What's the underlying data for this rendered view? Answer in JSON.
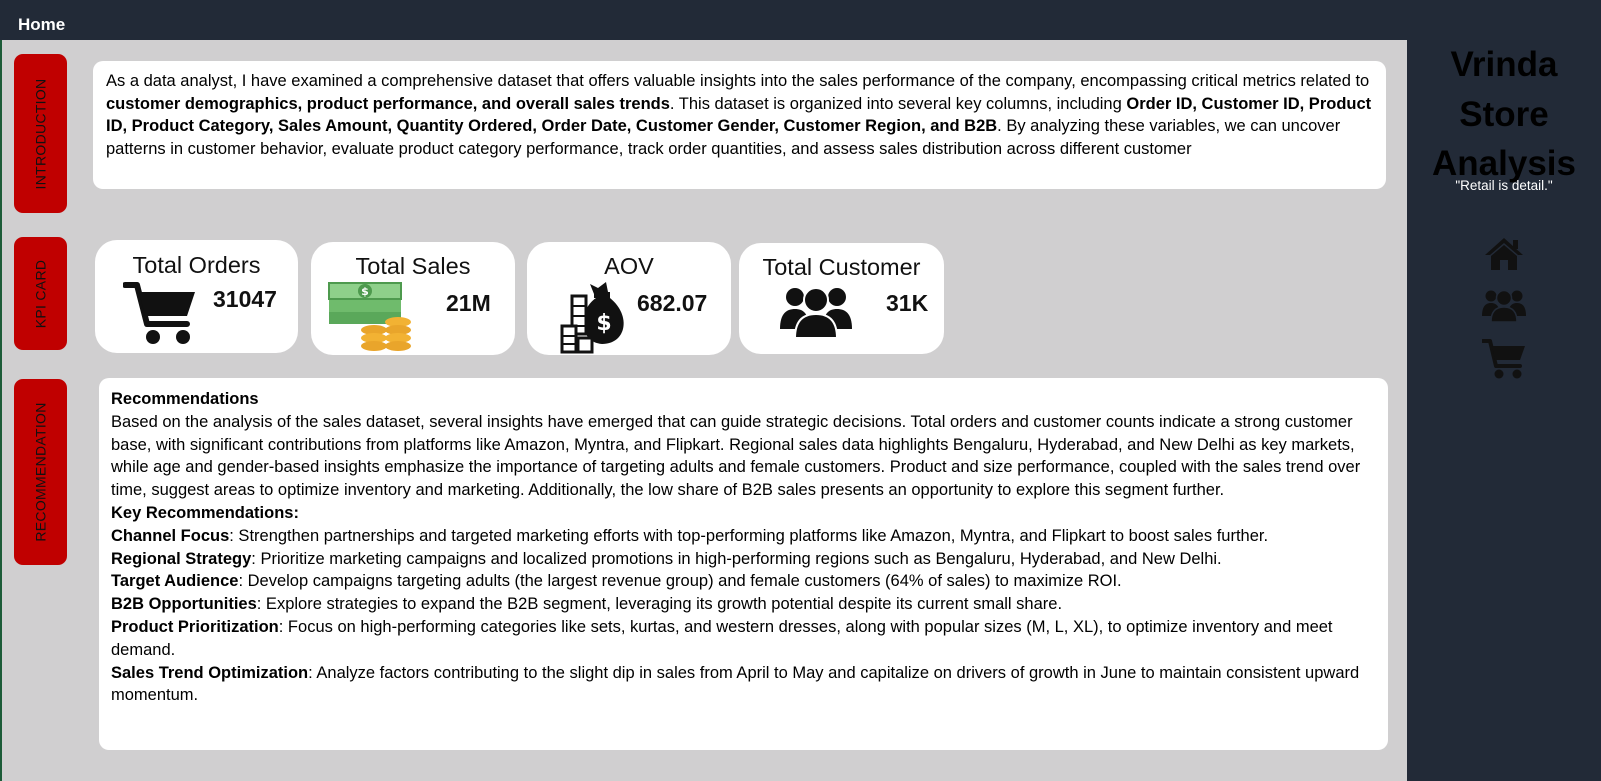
{
  "header": {
    "home_label": "Home"
  },
  "sections": {
    "introduction": "INTRODUCTION",
    "kpi": "KPI CARD",
    "recommendation": "RECOMMENDATION"
  },
  "intro": {
    "t1": "As a data analyst, I have examined a comprehensive dataset that offers valuable insights into the sales performance of the company, encompassing critical metrics related  to ",
    "b1": "customer demographics, product performance, and overall sales trends",
    "t2": ". This dataset is organized into several key columns, including ",
    "b2": "Order ID, Customer ID, Product ID, Product Category, Sales Amount, Quantity Ordered, Order Date, Customer Gender, Customer Region, and B2B",
    "t3": ". By analyzing these variables, we can uncover patterns in customer behavior, evaluate product category performance, track order quantities, and assess sales distribution across different customer"
  },
  "kpis": {
    "orders": {
      "label": "Total Orders",
      "value": "31047",
      "icon": "shopping-cart-icon"
    },
    "sales": {
      "label": "Total Sales",
      "value": "21M",
      "icon": "money-stack-icon"
    },
    "aov": {
      "label": "AOV",
      "value": "682.07",
      "icon": "money-bag-icon"
    },
    "customers": {
      "label": "Total Customer",
      "value": "31K",
      "icon": "users-icon"
    }
  },
  "recommendations": {
    "heading": "Recommendations",
    "summary": "Based on the analysis of the sales dataset, several insights have emerged that can guide strategic decisions. Total orders and customer counts indicate a strong customer base, with significant contributions from platforms like Amazon, Myntra, and Flipkart. Regional sales data highlights Bengaluru, Hyderabad, and New Delhi as key markets, while age and gender-based insights emphasize the importance of targeting adults and female customers. Product and size performance, coupled with the sales trend over time, suggest areas to optimize inventory and marketing. Additionally, the low share of B2B sales presents an opportunity to explore this segment further.",
    "key_heading": "Key Recommendations:",
    "items": [
      {
        "title": "Channel Focus",
        "text": ": Strengthen partnerships and targeted marketing efforts with top-performing platforms like Amazon, Myntra, and Flipkart to boost sales further."
      },
      {
        "title": "Regional Strategy",
        "text": ": Prioritize marketing campaigns and localized promotions in high-performing regions such as Bengaluru, Hyderabad, and New Delhi."
      },
      {
        "title": "Target Audience",
        "text": ": Develop campaigns targeting adults (the largest revenue group) and female customers (64% of sales) to maximize ROI."
      },
      {
        "title": "B2B Opportunities",
        "text": ": Explore strategies to expand the B2B segment, leveraging its growth potential despite its current small share."
      },
      {
        "title": "Product Prioritization",
        "text": ": Focus on high-performing categories like sets, kurtas, and western dresses, along with popular sizes (M, L, XL), to optimize inventory and meet demand."
      },
      {
        "title": "Sales Trend Optimization",
        "text": ": Analyze factors contributing to the slight dip in sales from April to May and capitalize on drivers of growth in June to maintain consistent upward momentum."
      }
    ]
  },
  "sidebar": {
    "brand_line1": "Vrinda",
    "brand_line2": "Store",
    "brand_line3": "Analysis",
    "tagline": "\"Retail is detail.\"",
    "nav": [
      "home-icon",
      "users-icon",
      "shopping-cart-icon"
    ]
  },
  "colors": {
    "topbar": "#222a37",
    "sidebar": "#222a37",
    "section_label": "#c00000",
    "canvas": "#d0cfd0",
    "money_green": "#7fc97a",
    "coin_gold": "#f2b233"
  }
}
